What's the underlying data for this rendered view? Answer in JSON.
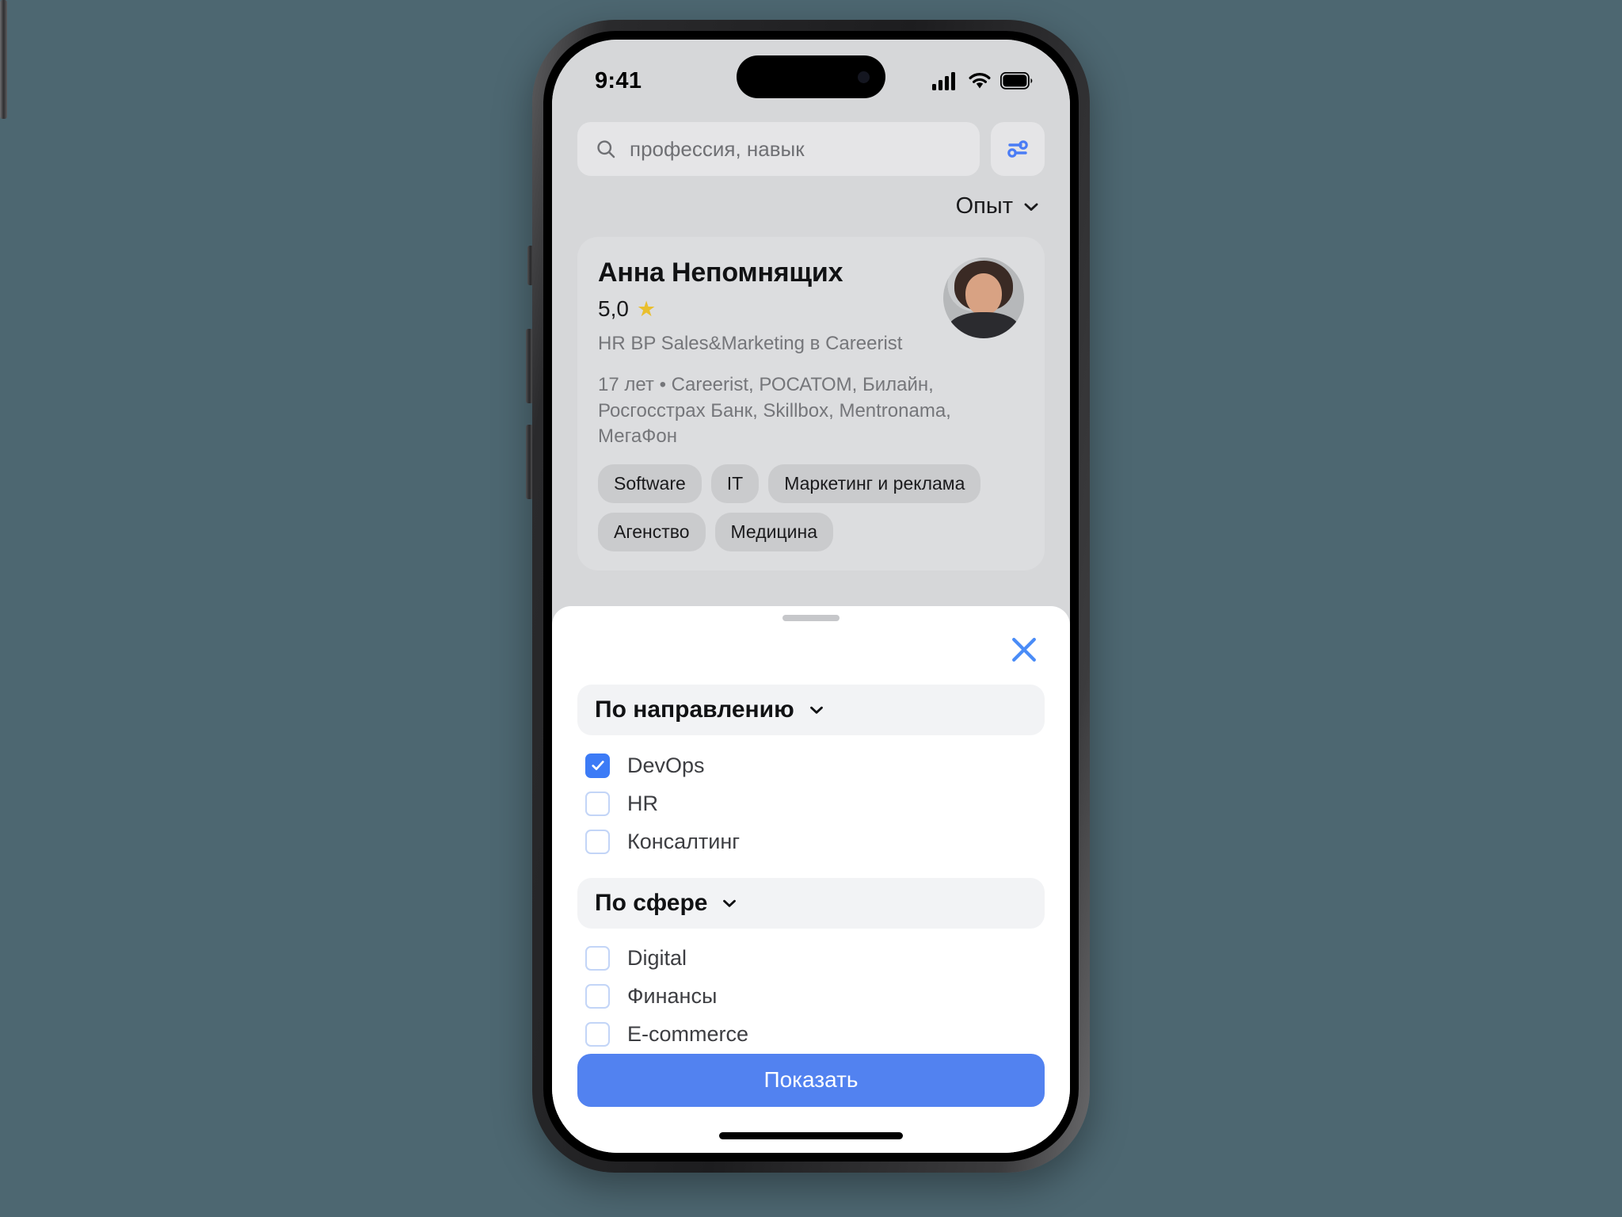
{
  "status_bar": {
    "time": "9:41",
    "icons": [
      "cellular-signal-icon",
      "wifi-icon",
      "battery-icon"
    ]
  },
  "search": {
    "placeholder": "профессия, навык",
    "icon": "search-icon",
    "filter_button_icon": "sliders-icon"
  },
  "sort": {
    "label": "Опыт",
    "icon": "chevron-down-icon"
  },
  "person_card": {
    "name": "Анна Непомнящих",
    "rating": "5,0",
    "rating_icon": "star-icon",
    "title": "HR BP Sales&Marketing в Careerist",
    "experience": "17 лет • Careerist, РОСАТОМ, Билайн, Росгосстрах Банк, Skillbox, Mentronama, МегаФон",
    "tags": [
      "Software",
      "IT",
      "Маркетинг и реклама",
      "Агенство",
      "Медицина"
    ],
    "avatar": "user-avatar-photo"
  },
  "sheet": {
    "close_icon": "close-icon",
    "handle": "drag-handle",
    "sections": [
      {
        "title": "По направлению",
        "icon": "chevron-down-icon",
        "options": [
          {
            "label": "DevOps",
            "checked": true
          },
          {
            "label": "HR",
            "checked": false
          },
          {
            "label": "Консалтинг",
            "checked": false
          }
        ]
      },
      {
        "title": "По сфере",
        "icon": "chevron-down-icon",
        "options": [
          {
            "label": "Digital",
            "checked": false
          },
          {
            "label": "Финансы",
            "checked": false
          },
          {
            "label": "E-commerce",
            "checked": false
          }
        ]
      }
    ],
    "submit_label": "Показать"
  },
  "colors": {
    "accent_blue": "#5282f0",
    "checkbox_blue": "#3c7bf6",
    "close_blue": "#4a8cf7",
    "page_background": "#4d6771",
    "screen_background": "#d6d7d9",
    "star_gold": "#e9bf2e"
  }
}
